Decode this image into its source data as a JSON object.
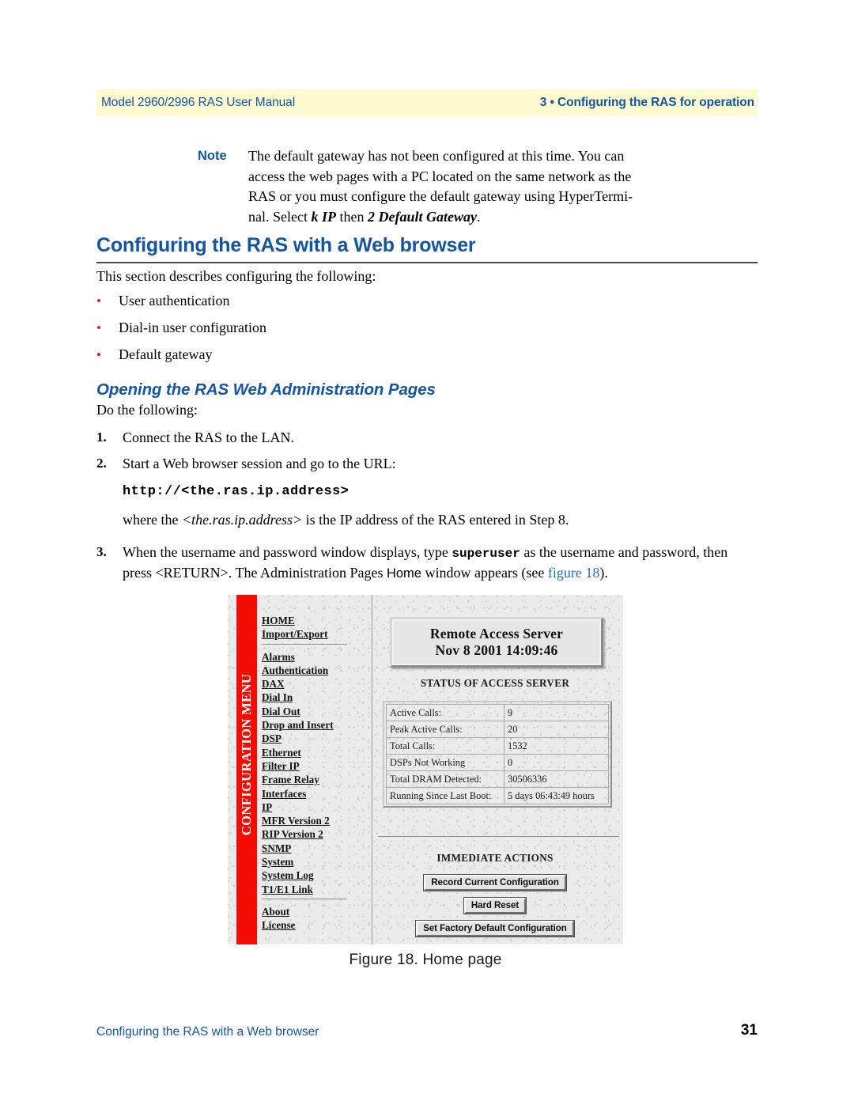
{
  "header": {
    "left": "Model 2960/2996 RAS User Manual",
    "right": "3 • Configuring the RAS for operation",
    "band_color": "#fdfbcf",
    "text_color": "#15549f"
  },
  "note": {
    "label": "Note",
    "line1": "The default gateway has not been configured at this time.  You can",
    "line2": "access the web pages with a PC located on the same network as the",
    "line3": "RAS or you must configure the default gateway using HyperTermi-",
    "line4_pre": "nal.  Select ",
    "line4_em1": "k IP",
    "line4_mid": " then ",
    "line4_em2": "2 Default Gateway",
    "line4_post": "."
  },
  "section": {
    "heading": "Configuring the RAS with a Web browser",
    "intro": "This section describes configuring the following:",
    "bullets": [
      "User authentication",
      "Dial-in user configuration",
      "Default gateway"
    ],
    "bullet_color": "#d52b1e"
  },
  "subsection": {
    "heading": "Opening the RAS Web Administration Pages",
    "lead": "Do the following:"
  },
  "steps": [
    {
      "num": "1.",
      "text": "Connect the RAS to the LAN."
    },
    {
      "num": "2.",
      "text": "Start a Web browser session and go to the URL:"
    }
  ],
  "step2": {
    "url": "http://<the.ras.ip.address>",
    "where_pre": "where the ",
    "where_em": "<the.ras.ip.address>",
    "where_post": " is the IP address of the RAS entered in Step 8."
  },
  "step3": {
    "num": "3.",
    "pre": "When the username and password window displays, type ",
    "mono": "superuser",
    "mid": " as the username and password, then press <RETURN>. The Administration Pages ",
    "sans": "Home",
    "mid2": " window appears (see ",
    "link": "figure 18",
    "post": ")."
  },
  "figure": {
    "caption": "Figure 18. Home page",
    "menu_bar_label": "CONFIGURATION MENU",
    "menu_bar_color": "#f40c02",
    "menu_group_1": [
      "HOME",
      "Import/Export"
    ],
    "menu_group_2": [
      "Alarms",
      "Authentication",
      "DAX",
      "Dial In",
      "Dial Out",
      "Drop and Insert",
      "DSP",
      "Ethernet",
      "Filter IP",
      "Frame Relay",
      "Interfaces",
      "IP",
      "MFR Version 2",
      "RIP Version 2",
      "SNMP",
      "System",
      "System Log",
      "T1/E1 Link"
    ],
    "menu_group_3": [
      "About",
      "License"
    ],
    "title_line1": "Remote Access Server",
    "title_line2": "Nov 8 2001 14:09:46",
    "status_caption": "STATUS OF ACCESS SERVER",
    "status_rows": [
      {
        "label": "Active Calls:",
        "value": "9"
      },
      {
        "label": "Peak Active Calls:",
        "value": "20"
      },
      {
        "label": "Total Calls:",
        "value": "1532"
      },
      {
        "label": "DSPs Not Working",
        "value": "0"
      },
      {
        "label": "Total DRAM Detected:",
        "value": "30506336"
      },
      {
        "label": "Running Since Last Boot:",
        "value": "5 days 06:43:49 hours"
      }
    ],
    "actions_caption": "IMMEDIATE ACTIONS",
    "buttons": [
      "Record Current Configuration",
      "Hard Reset",
      "Set Factory Default Configuration"
    ]
  },
  "footer": {
    "left": "Configuring the RAS with a Web browser",
    "page": "31"
  }
}
